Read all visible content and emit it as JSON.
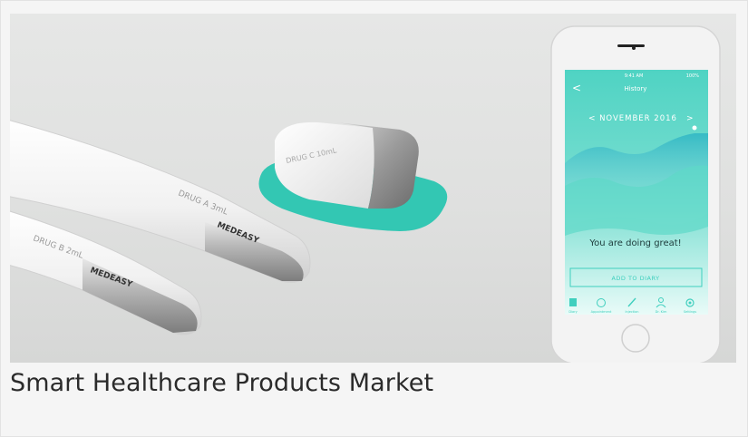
{
  "caption": {
    "title": "Smart Healthcare Products Market"
  },
  "product_labels": {
    "pen_a_drug": "DRUG A 3mL",
    "pen_b_drug": "DRUG B 2mL",
    "capsule_drug": "DRUG C 10mL",
    "brand_logo": "MEDEASY"
  },
  "phone": {
    "status_time": "9:41 AM",
    "status_battery": "100%",
    "header_title": "History",
    "month_label": "NOVEMBER 2016",
    "prev_symbol": "<",
    "next_symbol": ">",
    "back_symbol": "<",
    "message": "You are doing great!",
    "add_button_label": "ADD TO DIARY",
    "tabs": [
      {
        "label": "Diary",
        "icon": "book-icon"
      },
      {
        "label": "Appointment",
        "icon": "clock-icon"
      },
      {
        "label": "Injection",
        "icon": "pen-icon"
      },
      {
        "label": "Dr. Kim",
        "icon": "person-icon"
      },
      {
        "label": "Settings",
        "icon": "gear-icon"
      }
    ]
  },
  "colors": {
    "accent": "#3fcfbe",
    "chart_top": "#54d6c6",
    "chart_bottom": "#9fe8dd",
    "pen_tip": "#9a9a9a"
  }
}
